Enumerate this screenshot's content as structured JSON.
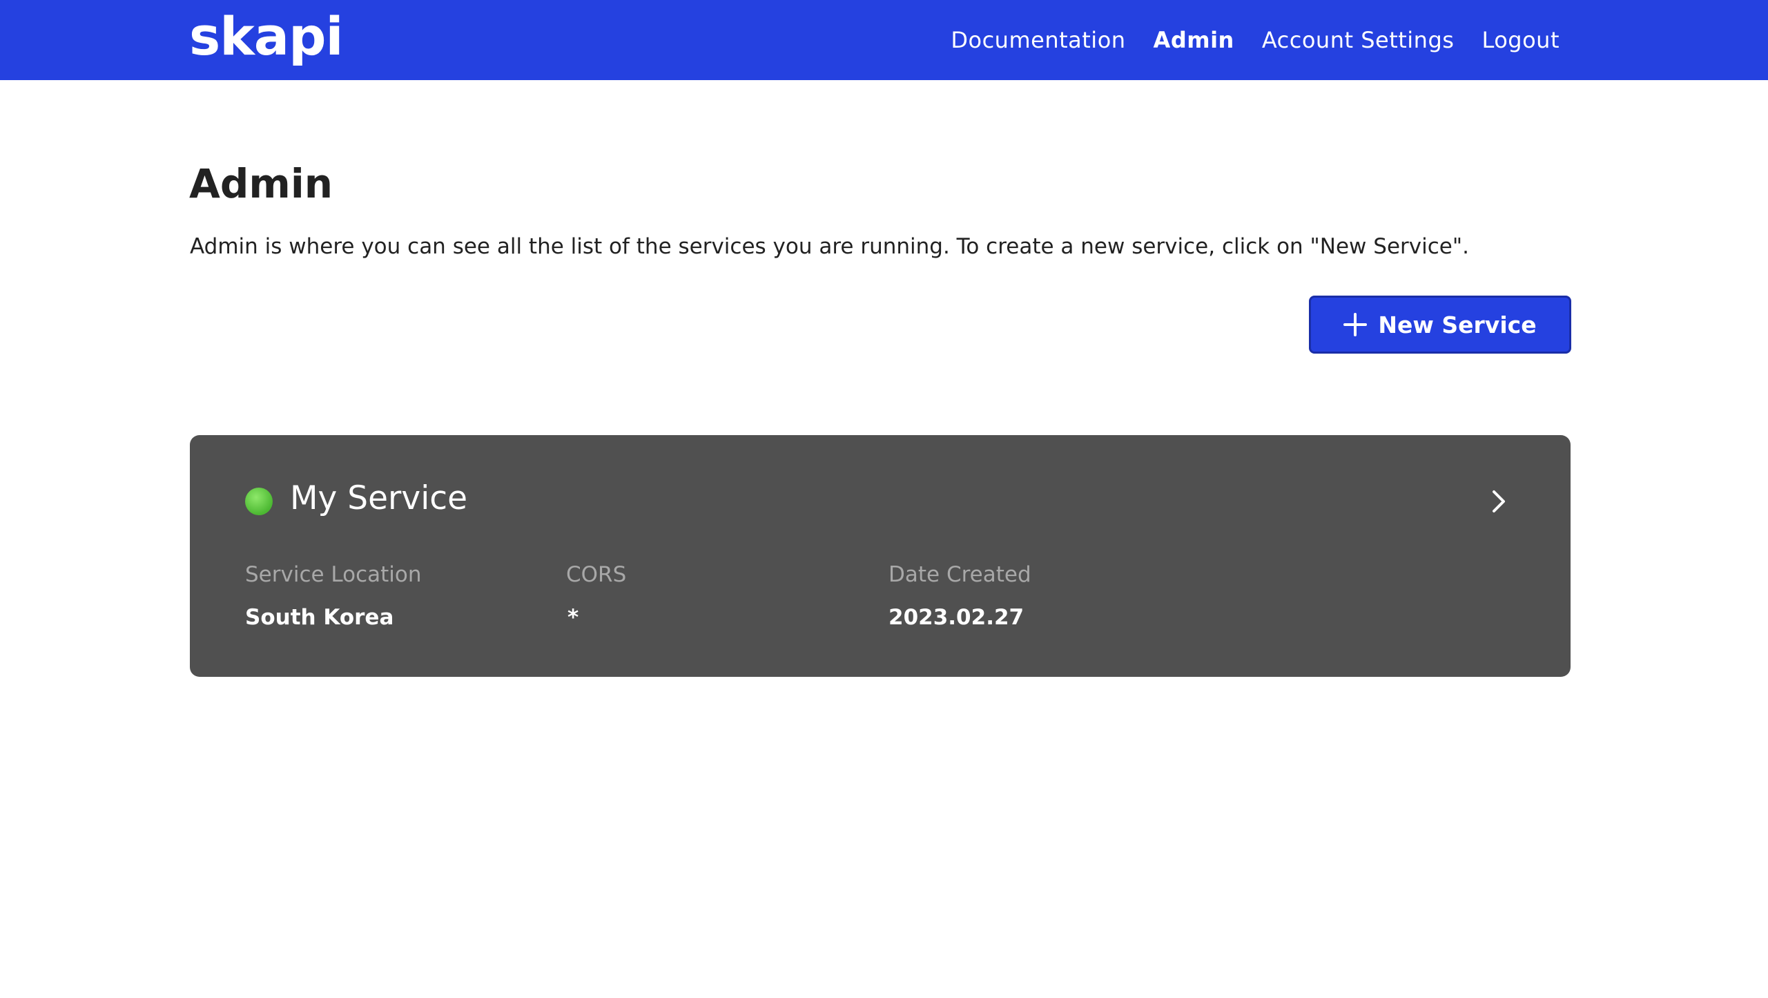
{
  "header": {
    "logo": "skapi",
    "nav": [
      {
        "label": "Documentation"
      },
      {
        "label": "Admin"
      },
      {
        "label": "Account Settings"
      },
      {
        "label": "Logout"
      }
    ],
    "active_nav": "Admin",
    "brand_color": "#2541e0"
  },
  "main": {
    "title": "Admin",
    "description": "Admin is where you can see all the list of the services you are running. To create a new service, click on \"New Service\".",
    "new_service_button": {
      "label": "New Service",
      "icon": "plus-icon"
    }
  },
  "services": [
    {
      "name": "My Service",
      "status_color": "#5cc83c",
      "fields": [
        {
          "label": "Service Location",
          "value": "South Korea"
        },
        {
          "label": "CORS",
          "value": "*"
        },
        {
          "label": "Date Created",
          "value": "2023.02.27"
        }
      ],
      "card_color": "#505050",
      "icon": "chevron-right-icon"
    }
  ]
}
